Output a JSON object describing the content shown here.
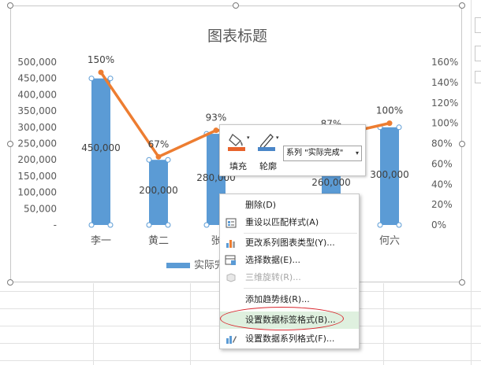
{
  "chart_data": {
    "type": "bar",
    "title": "图表标题",
    "categories": [
      "李一",
      "黄二",
      "张三",
      "",
      "",
      "何六"
    ],
    "category_labels_visible": [
      "李一",
      "黄二",
      "张",
      "",
      "",
      "何六"
    ],
    "series": [
      {
        "name": "实际完成",
        "type": "bar",
        "axis": "primary",
        "values": [
          450000,
          200000,
          280000,
          null,
          260000,
          300000
        ],
        "data_labels": [
          "450,000",
          "200,000",
          "280,000",
          "",
          "260,000",
          "300,000"
        ]
      },
      {
        "type": "line",
        "axis": "secondary",
        "values": [
          1.5,
          0.67,
          0.93,
          null,
          0.87,
          1.0
        ],
        "data_labels": [
          "150%",
          "67%",
          "93%",
          "",
          "87%",
          "100%"
        ]
      }
    ],
    "y_primary": {
      "range": [
        0,
        500000
      ],
      "ticks": [
        "-",
        "50,000",
        "100,000",
        "150,000",
        "200,000",
        "250,000",
        "300,000",
        "350,000",
        "400,000",
        "450,000",
        "500,000"
      ]
    },
    "y_secondary": {
      "range": [
        0,
        1.6
      ],
      "ticks": [
        "0%",
        "20%",
        "40%",
        "60%",
        "80%",
        "100%",
        "120%",
        "140%",
        "160%"
      ]
    },
    "legend": {
      "placement": "bottom",
      "visible_text": "实际完"
    },
    "colors": {
      "bar": "#5b9bd5",
      "line": "#ed7d31"
    },
    "gridlines": false
  },
  "mini_toolbar": {
    "fill_label": "填充",
    "outline_label": "轮廓",
    "series_selector": "系列 \"实际完成\"",
    "fill_icon": "paint-bucket-icon",
    "outline_icon": "pen-icon"
  },
  "context_menu": {
    "items": [
      {
        "label": "删除(D)",
        "icon": "",
        "enabled": true
      },
      {
        "label": "重设以匹配样式(A)",
        "icon": "reset-style-icon",
        "enabled": true
      },
      {
        "label": "更改系列图表类型(Y)...",
        "icon": "chart-type-icon",
        "enabled": true
      },
      {
        "label": "选择数据(E)...",
        "icon": "select-data-icon",
        "enabled": true
      },
      {
        "label": "三维旋转(R)...",
        "icon": "rotate-3d-icon",
        "enabled": false
      },
      {
        "label": "添加趋势线(R)...",
        "icon": "",
        "enabled": true
      },
      {
        "label": "设置数据标签格式(B)...",
        "icon": "",
        "enabled": true,
        "highlighted": true
      },
      {
        "label": "设置数据系列格式(F)...",
        "icon": "format-series-icon",
        "enabled": true
      }
    ]
  }
}
